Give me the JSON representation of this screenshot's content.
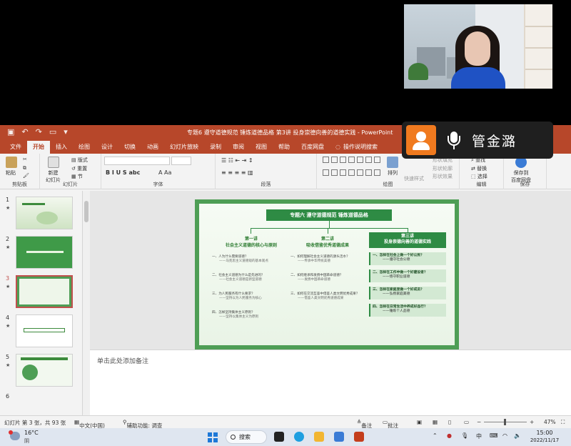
{
  "window": {
    "title": "专题6 遵守道德规范 锤炼道德品格 第3讲 投身崇德向善的道德实践 - PowerPoint"
  },
  "menu": {
    "tabs": [
      "文件",
      "开始",
      "插入",
      "绘图",
      "设计",
      "切换",
      "动画",
      "幻灯片放映",
      "录制",
      "审阅",
      "视图",
      "帮助",
      "百度网盘",
      "操作说明搜索"
    ],
    "active": "开始"
  },
  "ribbon": {
    "paste": "粘贴",
    "clipboard": "剪贴板",
    "new_slide": "新建",
    "new_slide2": "幻灯片",
    "slides": "幻灯片",
    "layout": "版式",
    "reset": "重置",
    "section": "节",
    "font": "字体",
    "paragraph": "段落",
    "drawing": "绘图",
    "arrange": "排列",
    "quick_styles": "快速样式",
    "shape_fill": "形状填充",
    "shape_outline": "形状轮廓",
    "shape_effect": "形状效果",
    "find": "查找",
    "replace": "替换",
    "select": "选择",
    "editing": "编辑",
    "save_baidu": "保存到",
    "save_baidu2": "百度网盘",
    "save_group": "保存"
  },
  "call": {
    "name": "管金潞"
  },
  "thumbnails": [
    {
      "num": "1",
      "star": "★"
    },
    {
      "num": "2",
      "star": "★"
    },
    {
      "num": "3",
      "star": "★"
    },
    {
      "num": "4",
      "star": "★"
    },
    {
      "num": "5",
      "star": "★"
    },
    {
      "num": "6",
      "star": ""
    }
  ],
  "slide": {
    "title": "专题六  遵守道德规范  锤炼道德品格",
    "col1": {
      "head1": "第一讲",
      "head2": "社会主义道德的核心与原则",
      "items": [
        {
          "q": "一、人为什么需要道德？",
          "a": "——马克思主义道德观的基本观点"
        },
        {
          "q": "二、社会主义道德为什么是先进的？",
          "a": "——社会主义道德是新型道德"
        },
        {
          "q": "三、为人民服务有什么要求？",
          "a": "——坚持以为人民服务为核心"
        },
        {
          "q": "四、怎样坚持集体主义原则？",
          "a": "——坚持以集体主义为原则"
        }
      ]
    },
    "col2": {
      "head1": "第二讲",
      "head2": "吸收借鉴优秀道德成果",
      "items": [
        {
          "q": "一、如何理解社会主义道德的源头活水？",
          "a": "——传承中华传统美德"
        },
        {
          "q": "二、如何继承和发扬中国革命道德？",
          "a": "——发扬中国革命道德"
        },
        {
          "q": "三、如何在交流互鉴中借鉴人类文明优秀成果？",
          "a": "——借鉴人类文明优秀道德成果"
        }
      ]
    },
    "col3": {
      "head1": "第三讲",
      "head2": "投身崇德向善的道德实践",
      "items": [
        {
          "q": "一、怎样在社会上做一个好公民？",
          "a": "——遵守社会公德"
        },
        {
          "q": "二、怎样在工作中做一个好建设者？",
          "a": "——恪守职业道德"
        },
        {
          "q": "三、怎样在家庭里做一个好成员？",
          "a": "——弘扬家庭美德"
        },
        {
          "q": "四、怎样在日常生活中养成好品行？",
          "a": "——锤炼个人品德"
        }
      ]
    }
  },
  "notes": {
    "placeholder": "单击此处添加备注"
  },
  "status": {
    "slide_info": "幻灯片 第 3 张，共 93 张",
    "language": "中文(中国)",
    "accessibility": "辅助功能: 调查",
    "notes_btn": "备注",
    "comments_btn": "批注",
    "zoom": "47%"
  },
  "taskbar": {
    "temp": "16°C",
    "cond": "阴",
    "search": "搜索",
    "ime": "中",
    "time": "15:00",
    "date": "2022/11/17"
  }
}
